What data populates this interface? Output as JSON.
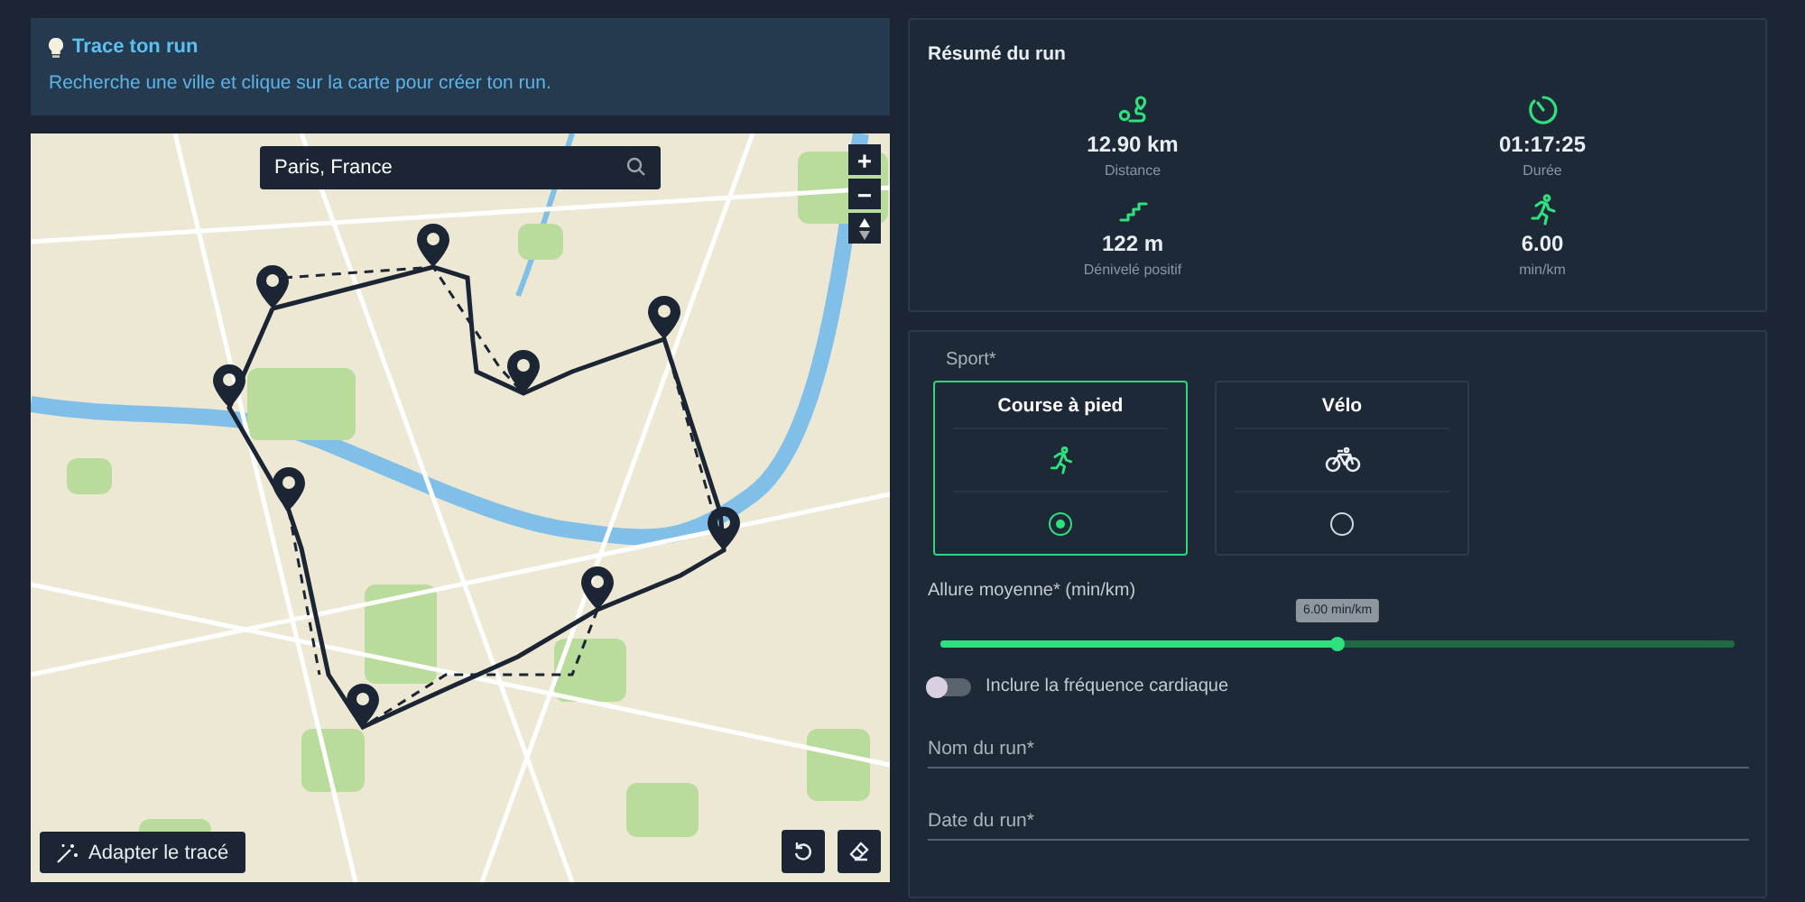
{
  "hint": {
    "title": "Trace ton run",
    "text": "Recherche une ville et clique sur la carte pour créer ton run."
  },
  "map": {
    "search": {
      "value": "Paris, France"
    },
    "zoom_buttons": [
      "+",
      "−"
    ],
    "fit_button": "Adapter le tracé"
  },
  "summary": {
    "title": "Résumé du run",
    "stats": [
      {
        "kind": "distance",
        "value": "12.90 km",
        "label": "Distance"
      },
      {
        "kind": "duration",
        "value": "01:17:25",
        "label": "Durée"
      },
      {
        "kind": "elevation",
        "value": "122 m",
        "label": "Dénivelé positif"
      },
      {
        "kind": "pace",
        "value": "6.00",
        "label": "min/km"
      }
    ]
  },
  "form": {
    "sport_label": "Sport*",
    "sports": [
      {
        "kind": "run",
        "label": "Course à pied",
        "selected": true
      },
      {
        "kind": "bike",
        "label": "Vélo",
        "selected": false
      }
    ],
    "pace": {
      "label": "Allure moyenne* (min/km)",
      "tooltip": "6.00 min/km",
      "level": 0.5
    },
    "heart_rate": {
      "label": "Inclure la fréquence cardiaque",
      "on": false
    },
    "fields": [
      {
        "placeholder": "Nom du run*"
      },
      {
        "placeholder": "Date du run*"
      }
    ]
  }
}
